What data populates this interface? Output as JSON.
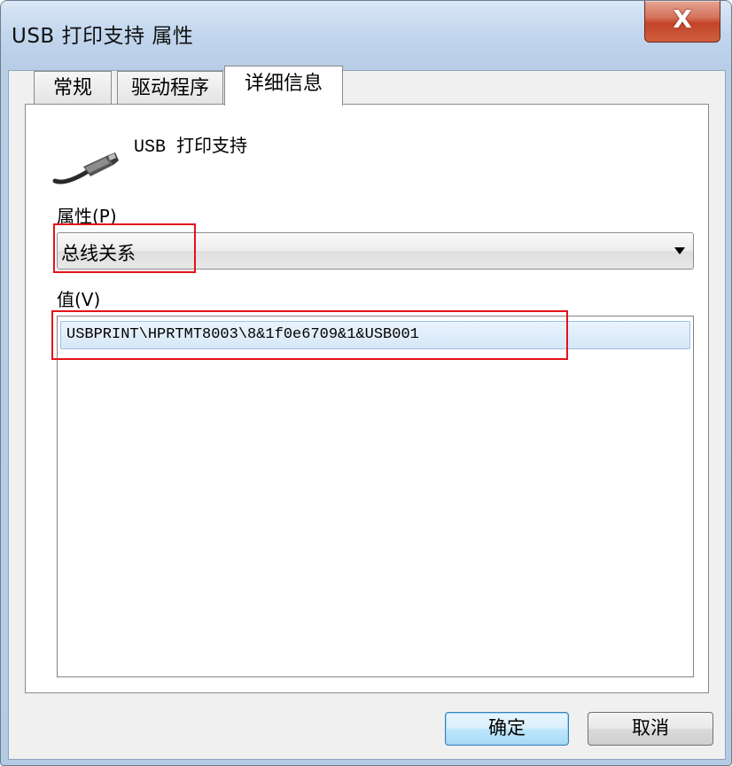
{
  "window": {
    "title": "USB 打印支持 属性",
    "close_label": "X"
  },
  "tabs": [
    {
      "label": "常规"
    },
    {
      "label": "驱动程序"
    },
    {
      "label": "详细信息",
      "active": true
    }
  ],
  "device": {
    "name": "USB 打印支持",
    "icon": "usb-cable-icon"
  },
  "property": {
    "label": "属性(P)",
    "selected": "总线关系"
  },
  "value": {
    "label": "值(V)",
    "items": [
      "USBPRINT\\HPRTMT8003\\8&1f0e6709&1&USB001"
    ]
  },
  "buttons": {
    "ok": "确定",
    "cancel": "取消"
  },
  "colors": {
    "annotation": "#e3131a",
    "selection": "#d6e7f8"
  }
}
